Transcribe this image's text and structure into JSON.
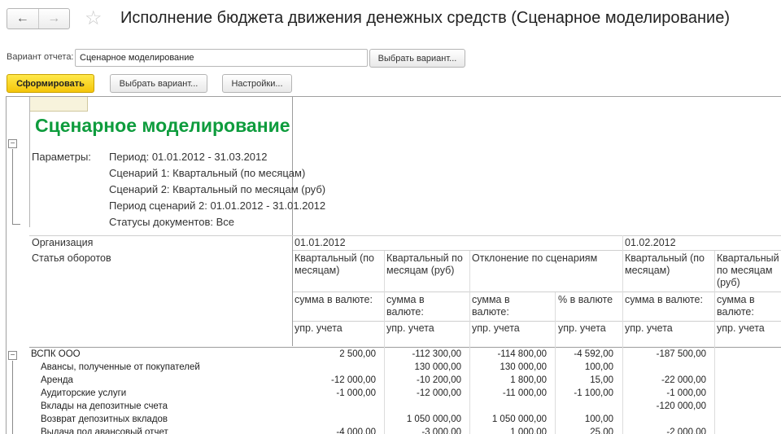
{
  "window": {
    "title": "Исполнение бюджета движения денежных средств (Сценарное моделирование)",
    "back_icon": "←",
    "forward_icon": "→",
    "star_icon": "☆"
  },
  "variant": {
    "label": "Вариант отчета:",
    "value": "Сценарное моделирование",
    "choose_button": "Выбрать вариант..."
  },
  "toolbar": {
    "generate": "Сформировать",
    "choose_variant": "Выбрать вариант...",
    "settings": "Настройки..."
  },
  "report": {
    "title": "Сценарное моделирование",
    "params_label": "Параметры:",
    "params": [
      "Период: 01.01.2012 - 31.03.2012",
      "Сценарий 1: Квартальный (по месяцам)",
      "Сценарий 2: Квартальный по месяцам (руб)",
      "Период сценарий 2: 01.01.2012 - 31.01.2012",
      "Статусы документов: Все"
    ],
    "header": {
      "org_label": "Организация",
      "article_label": "Статья оборотов",
      "date1": "01.01.2012",
      "date2": "01.02.2012",
      "scen1": "Квартальный (по месяцам)",
      "scen2": "Квартальный по месяцам (руб)",
      "deviation": "Отклонение по сценариям",
      "scen1b": "Квартальный (по месяцам)",
      "scen2b": "Квартальный по месяцам (руб)",
      "sum_short": "сумма в валюте:",
      "sum_wrap": "сумма в валюте:",
      "pct": "% в валюте",
      "mgmt": "упр. учета"
    },
    "rows": [
      {
        "name": "ВСПК ООО",
        "v": [
          "2 500,00",
          "-112 300,00",
          "-114 800,00",
          "-4 592,00",
          "-187 500,00",
          ""
        ]
      },
      {
        "name": "Авансы, полученные от покупателей",
        "v": [
          "",
          "130 000,00",
          "130 000,00",
          "100,00",
          "",
          ""
        ]
      },
      {
        "name": "Аренда",
        "v": [
          "-12 000,00",
          "-10 200,00",
          "1 800,00",
          "15,00",
          "-22 000,00",
          ""
        ]
      },
      {
        "name": "Аудиторские услуги",
        "v": [
          "-1 000,00",
          "-12 000,00",
          "-11 000,00",
          "-1 100,00",
          "-1 000,00",
          ""
        ]
      },
      {
        "name": "Вклады на депозитные счета",
        "v": [
          "",
          "",
          "",
          "",
          "-120 000,00",
          ""
        ]
      },
      {
        "name": "Возврат депозитных вкладов",
        "v": [
          "",
          "1 050 000,00",
          "1 050 000,00",
          "100,00",
          "",
          ""
        ]
      },
      {
        "name": "Выдача под авансовый отчет",
        "v": [
          "-4 000,00",
          "-3 000,00",
          "1 000,00",
          "25,00",
          "-2 000,00",
          ""
        ]
      }
    ]
  }
}
